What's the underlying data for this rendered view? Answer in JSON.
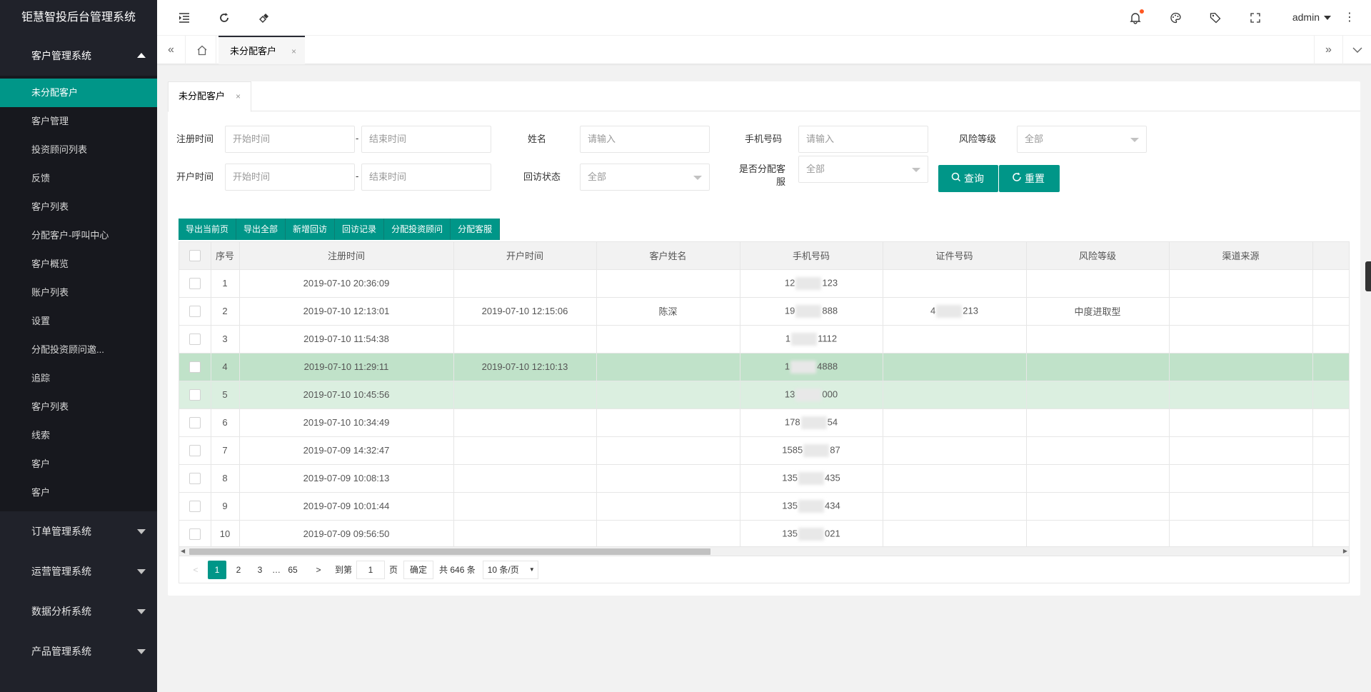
{
  "app": {
    "title": "钜慧智投后台管理系统"
  },
  "sidebar": {
    "active_group": {
      "label": "客户管理系统"
    },
    "items": [
      {
        "label": "未分配客户",
        "active": true
      },
      {
        "label": "客户管理"
      },
      {
        "label": "投资顾问列表"
      },
      {
        "label": "反馈"
      },
      {
        "label": "客户列表"
      },
      {
        "label": "分配客户-呼叫中心"
      },
      {
        "label": "客户概览"
      },
      {
        "label": "账户列表"
      },
      {
        "label": "设置"
      },
      {
        "label": "分配投资顾问邀..."
      },
      {
        "label": "追踪"
      },
      {
        "label": "客户列表"
      },
      {
        "label": "线索"
      },
      {
        "label": "客户"
      },
      {
        "label": "客户"
      }
    ],
    "groups": [
      {
        "label": "订单管理系统"
      },
      {
        "label": "运营管理系统"
      },
      {
        "label": "数据分析系统"
      },
      {
        "label": "产品管理系统"
      }
    ]
  },
  "header": {
    "user": "admin",
    "icons": [
      "menu-fold-icon",
      "refresh-icon",
      "clean-icon",
      "bell-icon",
      "theme-icon",
      "tag-icon",
      "fullscreen-icon",
      "more-icon"
    ]
  },
  "tabsbar": {
    "active_tab": "未分配客户",
    "close": "×"
  },
  "card": {
    "tab": "未分配客户",
    "close": "×"
  },
  "form": {
    "reg_time_label": "注册时间",
    "open_time_label": "开户时间",
    "start_placeholder": "开始时间",
    "end_placeholder": "结束时间",
    "dash": "-",
    "name_label": "姓名",
    "name_placeholder": "请输入",
    "phone_label": "手机号码",
    "phone_placeholder": "请输入",
    "risk_label": "风险等级",
    "risk_value": "全部",
    "visit_label": "回访状态",
    "visit_value": "全部",
    "assigned_label": "是否分配客服",
    "assigned_value": "全部",
    "search_label": "查询",
    "reset_label": "重置"
  },
  "toolbar": [
    "导出当前页",
    "导出全部",
    "新增回访",
    "回访记录",
    "分配投资顾问",
    "分配客服"
  ],
  "table": {
    "columns": [
      "序号",
      "注册时间",
      "开户时间",
      "客户姓名",
      "手机号码",
      "证件号码",
      "风险等级",
      "渠道来源"
    ],
    "rows": [
      {
        "no": "1",
        "reg": "2019-07-10 20:36:09",
        "open": "",
        "name": "",
        "phone_a": "12",
        "phone_b": "123",
        "id_a": "",
        "id_b": "",
        "risk": ""
      },
      {
        "no": "2",
        "reg": "2019-07-10 12:13:01",
        "open": "2019-07-10 12:15:06",
        "name": "陈深",
        "phone_a": "19",
        "phone_b": "888",
        "id_a": "4",
        "id_b": "213",
        "risk": "中度进取型"
      },
      {
        "no": "3",
        "reg": "2019-07-10 11:54:38",
        "open": "",
        "name": "",
        "phone_a": "1",
        "phone_b": "1112",
        "id_a": "",
        "id_b": "",
        "risk": ""
      },
      {
        "no": "4",
        "reg": "2019-07-10 11:29:11",
        "open": "2019-07-10 12:10:13",
        "name": "",
        "phone_a": "1",
        "phone_b": "4888",
        "id_a": "",
        "id_b": "",
        "risk": ""
      },
      {
        "no": "5",
        "reg": "2019-07-10 10:45:56",
        "open": "",
        "name": "",
        "phone_a": "13",
        "phone_b": "000",
        "id_a": "",
        "id_b": "",
        "risk": ""
      },
      {
        "no": "6",
        "reg": "2019-07-10 10:34:49",
        "open": "",
        "name": "",
        "phone_a": "178",
        "phone_b": "54",
        "id_a": "",
        "id_b": "",
        "risk": ""
      },
      {
        "no": "7",
        "reg": "2019-07-09 14:32:47",
        "open": "",
        "name": "",
        "phone_a": "1585",
        "phone_b": "87",
        "id_a": "",
        "id_b": "",
        "risk": ""
      },
      {
        "no": "8",
        "reg": "2019-07-09 10:08:13",
        "open": "",
        "name": "",
        "phone_a": "135",
        "phone_b": "435",
        "id_a": "",
        "id_b": "",
        "risk": ""
      },
      {
        "no": "9",
        "reg": "2019-07-09 10:01:44",
        "open": "",
        "name": "",
        "phone_a": "135",
        "phone_b": "434",
        "id_a": "",
        "id_b": "",
        "risk": ""
      },
      {
        "no": "10",
        "reg": "2019-07-09 09:56:50",
        "open": "",
        "name": "",
        "phone_a": "135",
        "phone_b": "021",
        "id_a": "",
        "id_b": "",
        "risk": ""
      }
    ]
  },
  "pager": {
    "prev": "<",
    "pages": [
      "1",
      "2",
      "3"
    ],
    "ellipsis": "…",
    "last": "65",
    "next": ">",
    "goto_label": "到第",
    "goto_value": "1",
    "page_unit": "页",
    "confirm": "确定",
    "total": "共 646 条",
    "size": "10 条/页"
  },
  "colors": {
    "accent": "#009688",
    "sidebar": "#20222a",
    "selected_row": "#c0e2c9"
  }
}
